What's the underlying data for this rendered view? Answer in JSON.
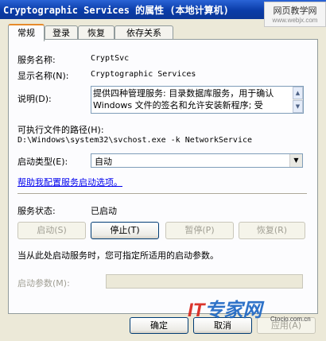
{
  "window": {
    "title": "Cryptographic Services 的属性 (本地计算机)"
  },
  "watermark_top": {
    "line1": "网页教学网",
    "line2": "www.webjx.com"
  },
  "tabs": [
    {
      "label": "常规",
      "active": true
    },
    {
      "label": "登录",
      "active": false
    },
    {
      "label": "恢复",
      "active": false
    },
    {
      "label": "依存关系",
      "active": false
    }
  ],
  "general": {
    "service_name_label": "服务名称:",
    "service_name": "CryptSvc",
    "display_name_label": "显示名称(N):",
    "display_name": "Cryptographic Services",
    "description_label": "说明(D):",
    "description": "提供四种管理服务: 目录数据库服务，用于确认 Windows 文件的签名和允许安装新程序; 受",
    "path_label": "可执行文件的路径(H):",
    "path": "D:\\Windows\\system32\\svchost.exe -k NetworkService",
    "startup_type_label": "启动类型(E):",
    "startup_type": "自动",
    "help_link": "帮助我配置服务启动选项。",
    "service_status_label": "服务状态:",
    "service_status": "已启动",
    "buttons": {
      "start": "启动(S)",
      "stop": "停止(T)",
      "pause": "暂停(P)",
      "resume": "恢复(R)"
    },
    "hint": "当从此处启动服务时，您可指定所适用的启动参数。",
    "start_params_label": "启动参数(M):",
    "start_params_value": ""
  },
  "footer": {
    "ok": "确定",
    "cancel": "取消",
    "apply": "应用(A)"
  },
  "watermark_bottom": {
    "logo_it": "IT",
    "logo_rest": "专家网",
    "sub": "Ctocio.com.cn"
  },
  "colors": {
    "titlebar": "#0a3ca8",
    "panel": "#fcfcfe",
    "dialog": "#ece9d8",
    "tab_accent": "#e68b2c",
    "link": "#0000ee"
  }
}
